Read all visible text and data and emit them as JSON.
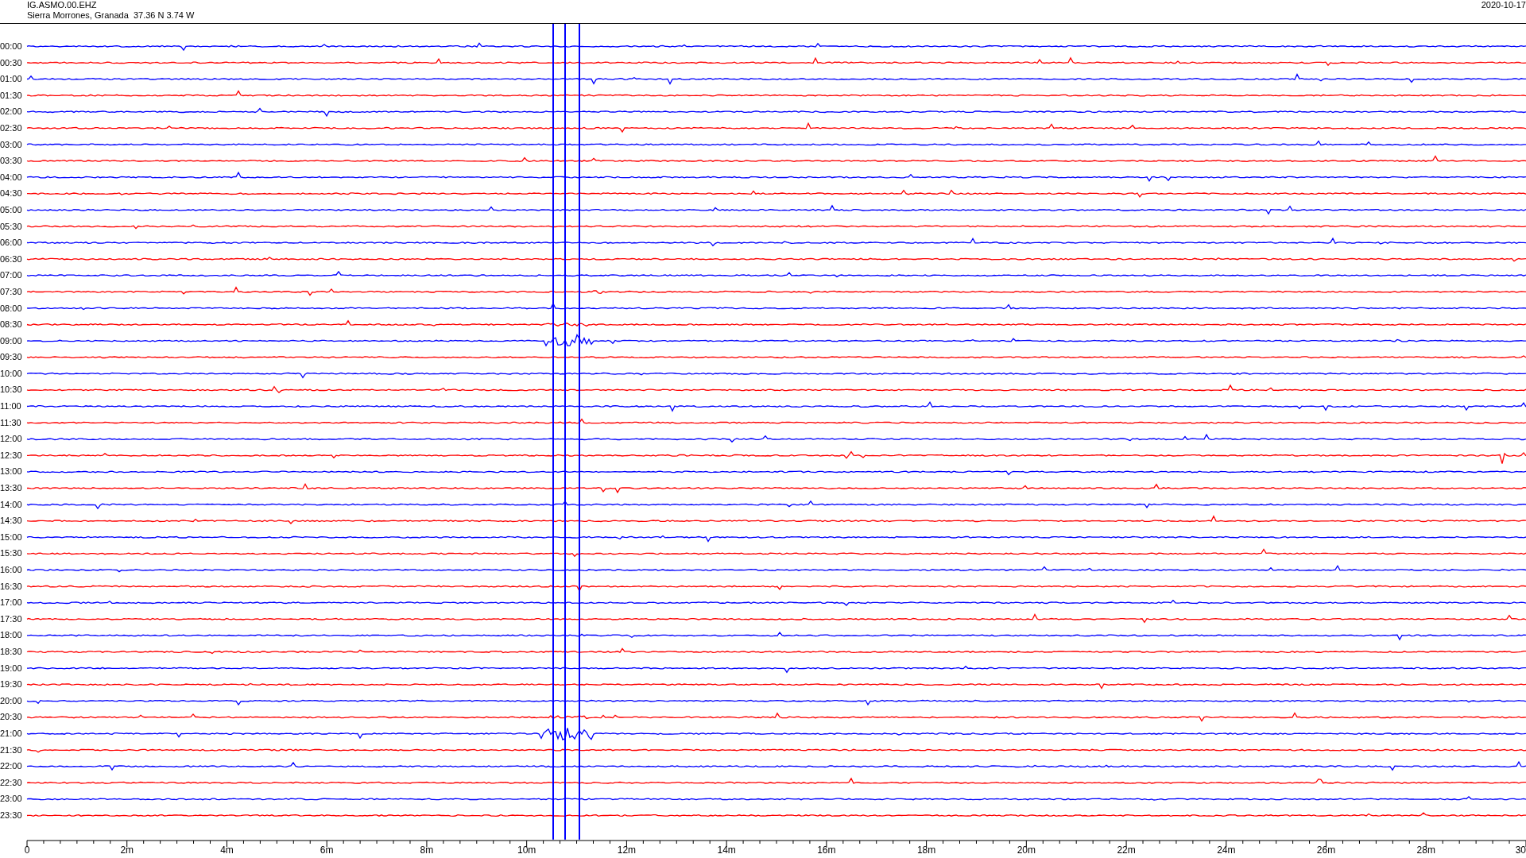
{
  "header": {
    "channel": "IG.ASMO.00.EHZ",
    "location": "Sierra Morrones, Granada  37.36 N 3.74 W",
    "date": "2020-10-17"
  },
  "rows": [
    {
      "time": "00:00",
      "color": "#0000ff"
    },
    {
      "time": "00:30",
      "color": "#ff0000"
    },
    {
      "time": "01:00",
      "color": "#0000ff"
    },
    {
      "time": "01:30",
      "color": "#ff0000"
    },
    {
      "time": "02:00",
      "color": "#0000ff"
    },
    {
      "time": "02:30",
      "color": "#ff0000"
    },
    {
      "time": "03:00",
      "color": "#0000ff"
    },
    {
      "time": "03:30",
      "color": "#ff0000"
    },
    {
      "time": "04:00",
      "color": "#0000ff"
    },
    {
      "time": "04:30",
      "color": "#ff0000"
    },
    {
      "time": "05:00",
      "color": "#0000ff"
    },
    {
      "time": "05:30",
      "color": "#ff0000"
    },
    {
      "time": "06:00",
      "color": "#0000ff"
    },
    {
      "time": "06:30",
      "color": "#ff0000"
    },
    {
      "time": "07:00",
      "color": "#0000ff"
    },
    {
      "time": "07:30",
      "color": "#ff0000"
    },
    {
      "time": "08:00",
      "color": "#0000ff"
    },
    {
      "time": "08:30",
      "color": "#ff0000"
    },
    {
      "time": "09:00",
      "color": "#0000ff"
    },
    {
      "time": "09:30",
      "color": "#ff0000"
    },
    {
      "time": "10:00",
      "color": "#0000ff"
    },
    {
      "time": "10:30",
      "color": "#ff0000"
    },
    {
      "time": "11:00",
      "color": "#0000ff"
    },
    {
      "time": "11:30",
      "color": "#ff0000"
    },
    {
      "time": "12:00",
      "color": "#0000ff"
    },
    {
      "time": "12:30",
      "color": "#ff0000"
    },
    {
      "time": "13:00",
      "color": "#0000ff"
    },
    {
      "time": "13:30",
      "color": "#ff0000"
    },
    {
      "time": "14:00",
      "color": "#0000ff"
    },
    {
      "time": "14:30",
      "color": "#ff0000"
    },
    {
      "time": "15:00",
      "color": "#0000ff"
    },
    {
      "time": "15:30",
      "color": "#ff0000"
    },
    {
      "time": "16:00",
      "color": "#0000ff"
    },
    {
      "time": "16:30",
      "color": "#ff0000"
    },
    {
      "time": "17:00",
      "color": "#0000ff"
    },
    {
      "time": "17:30",
      "color": "#ff0000"
    },
    {
      "time": "18:00",
      "color": "#0000ff"
    },
    {
      "time": "18:30",
      "color": "#ff0000"
    },
    {
      "time": "19:00",
      "color": "#0000ff"
    },
    {
      "time": "19:30",
      "color": "#ff0000"
    },
    {
      "time": "20:00",
      "color": "#0000ff"
    },
    {
      "time": "20:30",
      "color": "#ff0000"
    },
    {
      "time": "21:00",
      "color": "#0000ff"
    },
    {
      "time": "21:30",
      "color": "#ff0000"
    },
    {
      "time": "22:00",
      "color": "#0000ff"
    },
    {
      "time": "22:30",
      "color": "#ff0000"
    },
    {
      "time": "23:00",
      "color": "#0000ff"
    },
    {
      "time": "23:30",
      "color": "#ff0000"
    }
  ],
  "x_axis": {
    "ticks": [
      "0",
      "2m",
      "4m",
      "6m",
      "8m",
      "10m",
      "12m",
      "14m",
      "16m",
      "18m",
      "20m",
      "22m",
      "24m",
      "26m",
      "28m",
      "30"
    ]
  }
}
